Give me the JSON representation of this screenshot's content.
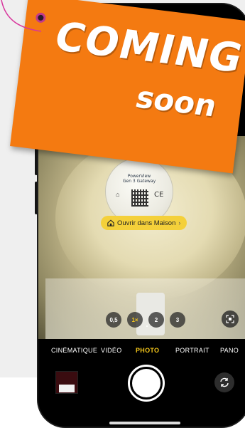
{
  "banner": {
    "line1": "COMING",
    "line2": "soon"
  },
  "camera": {
    "home_pill_label": "Ouvrir dans Maison",
    "zoom_levels": [
      "0,5",
      "1×",
      "2",
      "3"
    ],
    "active_zoom": "1×",
    "modes": [
      "CINÉMATIQUE",
      "VIDÉO",
      "PHOTO",
      "PORTRAIT",
      "PANO"
    ],
    "active_mode": "PHOTO"
  },
  "device_label": {
    "line1": "PowerView",
    "line2": "Gen 3 Gateway",
    "mark": "CE"
  },
  "colors": {
    "accent_yellow": "#f6c81b",
    "banner_orange": "#f47a11",
    "pill_yellow": "#f4d03a"
  },
  "icons": {
    "live_photo": "live-photo-off-icon",
    "home": "home-icon",
    "scan": "text-scan-icon",
    "flip": "camera-flip-icon"
  }
}
